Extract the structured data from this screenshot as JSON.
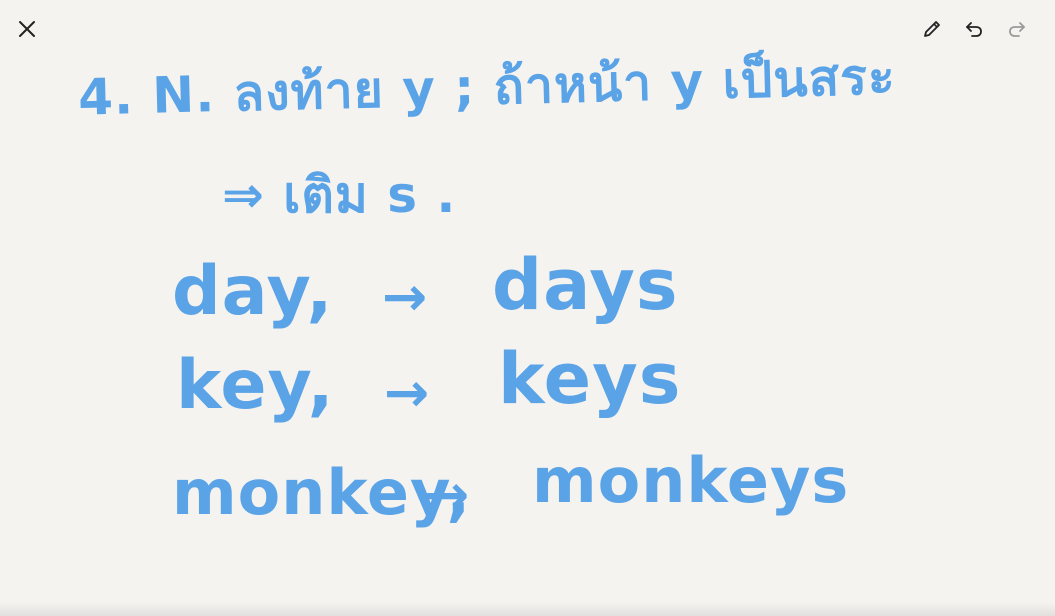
{
  "toolbar": {
    "close_icon": "close-icon",
    "pen_icon": "pen-icon",
    "undo_icon": "undo-icon",
    "redo_icon": "redo-icon"
  },
  "note": {
    "ink_color": "#5aa3e6",
    "rule_title": "4.  N. ลงท้าย y ; ถ้าหน้า y เป็นสระ",
    "rule_action": "⇒  เติม s .",
    "examples": [
      {
        "singular": "day,",
        "arrow": "→",
        "plural": "days"
      },
      {
        "singular": "key,",
        "arrow": "→",
        "plural": "keys"
      },
      {
        "singular": "monkey,",
        "arrow": "→",
        "plural": "monkeys"
      }
    ]
  }
}
